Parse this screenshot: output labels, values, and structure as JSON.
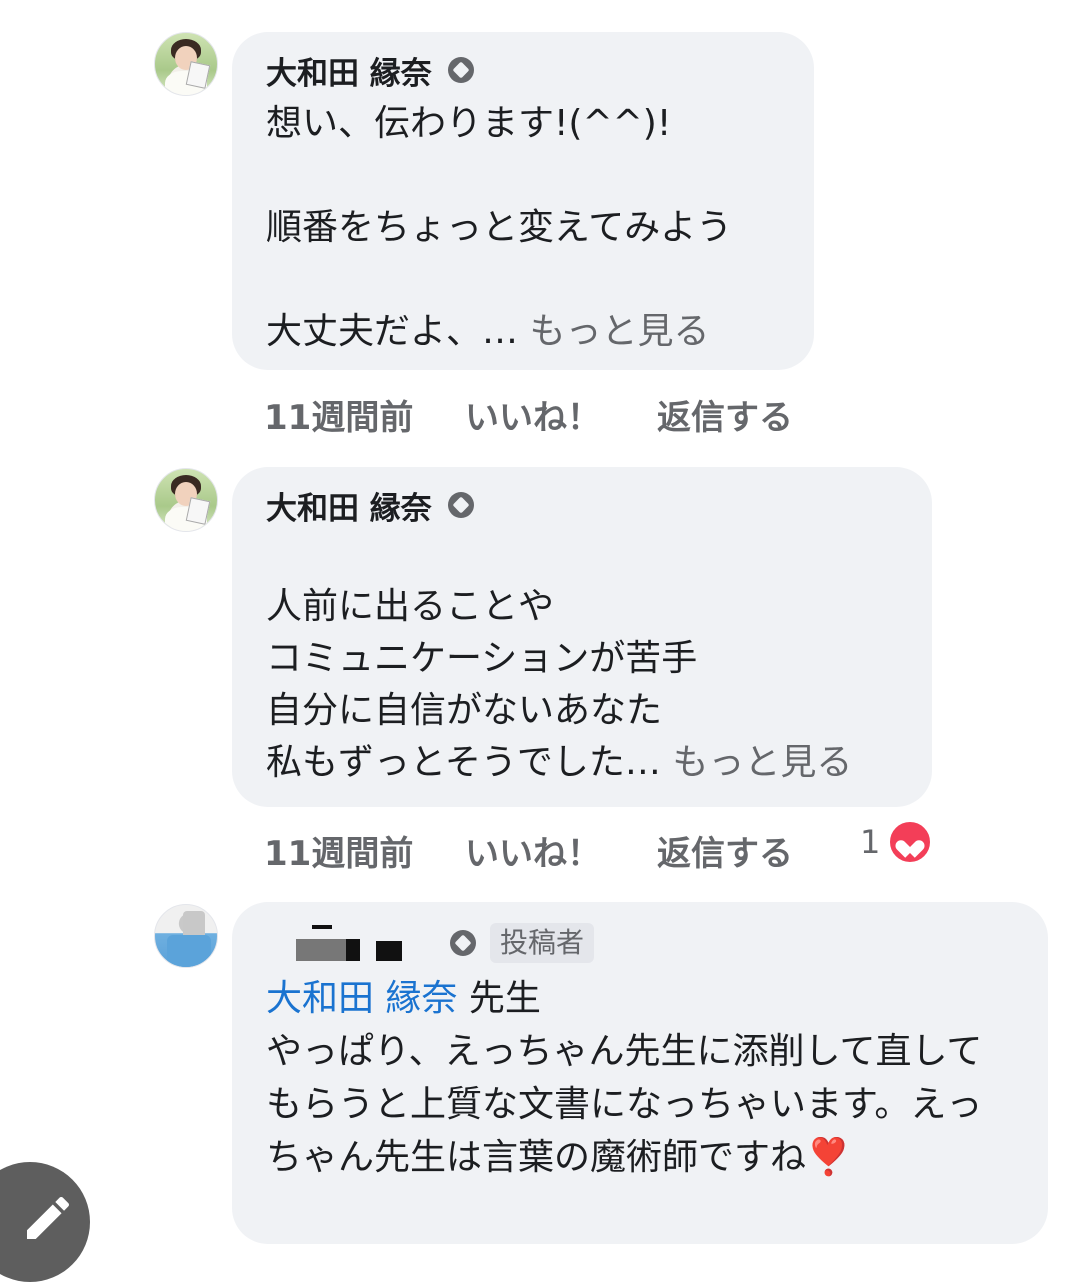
{
  "comments": [
    {
      "author": "大和田 縁奈",
      "text": "想い、伝わります!(^^)!\n\n順番をちょっと変えてみよう\n\n大丈夫だよ、…",
      "more_label": "もっと見る",
      "time": "11週間前",
      "like_label": "いいね！",
      "reply_label": "返信する"
    },
    {
      "author": "大和田 縁奈",
      "text": "人前に出ることや\nコミュニケーションが苦手\n自分に自信がないあなた\n私もずっとそうでした…",
      "more_label": "もっと見る",
      "time": "11週間前",
      "like_label": "いいね！",
      "reply_label": "返信する",
      "reaction_count": "1",
      "reaction_icon": "heart-icon"
    },
    {
      "author_badge": "投稿者",
      "mention": "大和田 縁奈",
      "mention_suffix": " 先生",
      "text": "やっぱり、えっちゃん先生に添削して直してもらうと上質な文書になっちゃいます。えっちゃん先生は言葉の魔術師ですね❣️"
    }
  ],
  "fab_icon": "pencil-icon"
}
